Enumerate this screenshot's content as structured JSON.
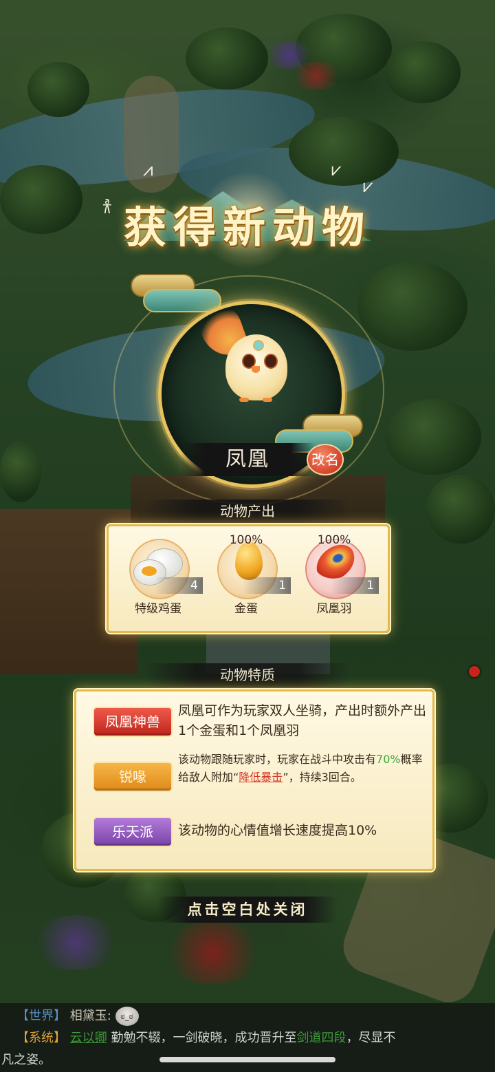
{
  "popup": {
    "title": "获得新动物",
    "animal_name": "凤凰",
    "rename_label": "改名",
    "close_hint": "点击空白处关闭"
  },
  "production": {
    "header": "动物产出",
    "items": [
      {
        "label": "特级鸡蛋",
        "count": "4",
        "chance": "",
        "icon": "egg-icon"
      },
      {
        "label": "金蛋",
        "count": "1",
        "chance": "100%",
        "icon": "golden-egg-icon"
      },
      {
        "label": "凤凰羽",
        "count": "1",
        "chance": "100%",
        "icon": "phoenix-feather-icon"
      }
    ]
  },
  "traits": {
    "header": "动物特质",
    "items": [
      {
        "badge": "凤凰神兽",
        "color": "#d9372a",
        "desc": "凤凰可作为玩家双人坐骑，产出时额外产出1个金蛋和1个凤凰羽"
      },
      {
        "badge": "锐喙",
        "color": "#e89a26",
        "desc_pre": "该动物跟随玩家时，玩家在战斗中攻击有",
        "desc_pct": "70%",
        "desc_mid": "概率给敌人附加“",
        "desc_link": "降低暴击",
        "desc_post": "”，持续3回合。"
      },
      {
        "badge": "乐天派",
        "color": "#9459c4",
        "desc": "该动物的心情值增长速度提高10%"
      }
    ]
  },
  "chat": {
    "line1": {
      "channel": "【世界】",
      "user": "相黛玉:",
      "emoji": "emoji-face-icon"
    },
    "line2": {
      "channel": "【系统】",
      "player": "云以卿",
      "text1": "勤勉不辍，一剑破晓，成功晋升至",
      "rank": "剑道四段",
      "text2": "，尽显不",
      "text3": "凡之姿。"
    }
  }
}
